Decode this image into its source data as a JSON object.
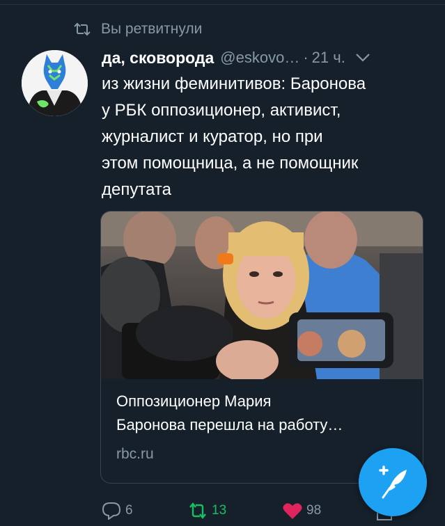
{
  "colors": {
    "background": "#15202b",
    "secondary_text": "#8899a6",
    "accent": "#1da1f2",
    "retweet_green": "#17bf63",
    "like_red": "#e0245e"
  },
  "retweet_notice": {
    "icon": "retweet-icon",
    "text": "Вы ретвитнули"
  },
  "tweet": {
    "avatar_icon": "avatar",
    "author_name": "да, сковорода",
    "handle": "@eskovo…",
    "separator": "·",
    "time": "21 ч.",
    "menu_icon": "chevron-down-icon",
    "text": "из жизни феминитивов: Баронова\nу РБК оппозиционер, активист,\nжурналист и куратор, но при\nэтом помощница, а не помощник\nдепутата",
    "card": {
      "title": "Оппозиционер Мария\nБаронова перешла на работу…",
      "domain": "rbc.ru"
    },
    "actions": {
      "reply_count": "6",
      "retweet_count": "13",
      "like_count": "98",
      "retweeted": true,
      "liked": true
    }
  },
  "compose_button": {
    "icon": "compose-feather-plus-icon"
  }
}
